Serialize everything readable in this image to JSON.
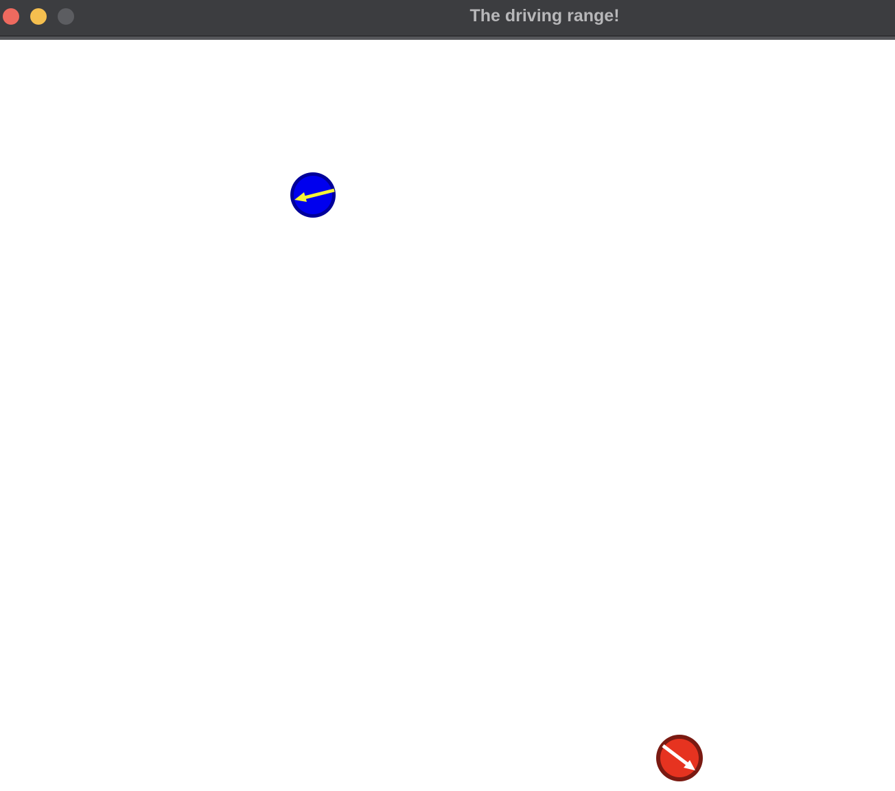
{
  "window": {
    "title": "The driving range!",
    "buttons": [
      {
        "name": "close",
        "color": "#ee6a5f"
      },
      {
        "name": "minimize",
        "color": "#f5bf4f"
      },
      {
        "name": "zoom",
        "color": "#5c5d61"
      }
    ]
  },
  "actors": [
    {
      "name": "blue-car",
      "body_color": "#0000ee",
      "rim_color": "#000099",
      "arrow_color": "#f7f536",
      "heading": "left"
    },
    {
      "name": "red-car",
      "body_color": "#e63320",
      "rim_color": "#7a1a12",
      "arrow_color": "#ffffff",
      "heading": "down-right"
    }
  ]
}
